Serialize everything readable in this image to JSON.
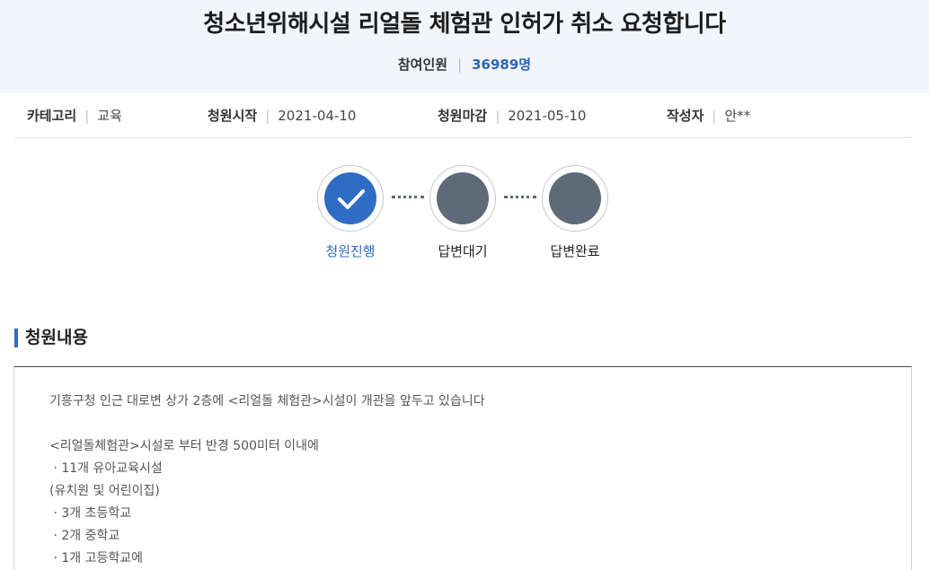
{
  "header": {
    "title": "청소년위해시설 리얼돌 체험관 인허가 취소 요청합니다",
    "participants_label": "참여인원",
    "participants_count": "36989명"
  },
  "meta": {
    "category_label": "카테고리",
    "category_value": "교육",
    "start_label": "청원시작",
    "start_value": "2021-04-10",
    "end_label": "청원마감",
    "end_value": "2021-05-10",
    "author_label": "작성자",
    "author_value": "안**"
  },
  "steps": [
    {
      "label": "청원진행",
      "state": "active",
      "icon": "check-icon"
    },
    {
      "label": "답변대기",
      "state": "pending"
    },
    {
      "label": "답변완료",
      "state": "pending"
    }
  ],
  "section": {
    "title": "청원내용"
  },
  "content": {
    "lines": [
      "기흥구청 인근 대로변 상가 2층에 <리얼돌 체험관>시설이 개관을 앞두고 있습니다",
      "",
      "<리얼돌체험관>시설로 부터 반경 500미터 이내에",
      " · 11개 유아교육시설",
      "(유치원 및 어린이집)",
      " · 3개 초등학교",
      " · 2개 중학교",
      " · 1개 고등학교에"
    ]
  },
  "colors": {
    "accent": "#2f6cc4",
    "pending": "#5f6a78",
    "header_bg": "#f2f5f9"
  }
}
